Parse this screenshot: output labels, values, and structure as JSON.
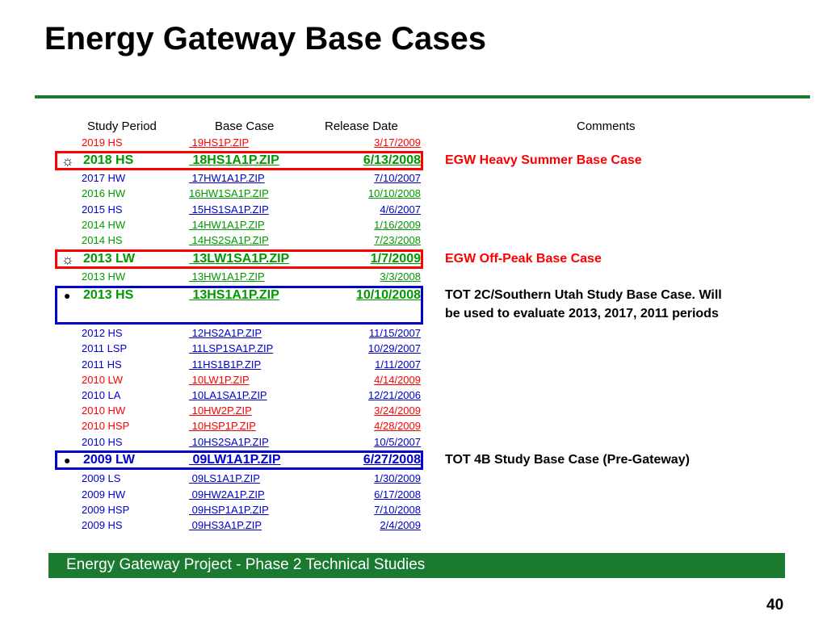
{
  "title": "Energy Gateway Base Cases",
  "headers": {
    "study_period": "Study Period",
    "base_case": "Base Case",
    "release_date": "Release Date",
    "comments": "Comments"
  },
  "rows": [
    {
      "period": "2019 HS",
      "file": "19HS1P.ZIP",
      "date": "3/17/2009",
      "color": "#ff0000",
      "style": "small"
    },
    {
      "period": "2018 HS",
      "file": "18HS1A1P.ZIP",
      "date": "6/13/2008",
      "color": "#009900",
      "style": "big",
      "marker": "☼",
      "comment": "EGW Heavy Summer Base Case",
      "comment_color": "#ff0000",
      "box_color": "#ff0000"
    },
    {
      "period": "2017 HW",
      "file": "17HW1A1P.ZIP",
      "date": "7/10/2007",
      "color": "#0000cc",
      "style": "small"
    },
    {
      "period": "2016 HW",
      "file": "16HW1SA1P.ZIP",
      "date": "10/10/2008",
      "color": "#009900",
      "style": "small"
    },
    {
      "period": "2015 HS",
      "file": "15HS1SA1P.ZIP",
      "date": "4/6/2007",
      "color": "#0000cc",
      "style": "small"
    },
    {
      "period": "2014 HW",
      "file": "14HW1A1P.ZIP",
      "date": "1/16/2009",
      "color": "#009900",
      "style": "small"
    },
    {
      "period": "2014 HS",
      "file": "14HS2SA1P.ZIP",
      "date": "7/23/2008",
      "color": "#009900",
      "style": "small"
    },
    {
      "period": "2013 LW",
      "file": "13LW1SA1P.ZIP",
      "date": "1/7/2009",
      "color": "#009900",
      "style": "big",
      "marker": "☼",
      "comment": "EGW Off-Peak Base Case",
      "comment_color": "#ff0000",
      "box_color": "#ff0000"
    },
    {
      "period": "2013 HW",
      "file": "13HW1A1P.ZIP",
      "date": "3/3/2008",
      "color": "#009900",
      "style": "small"
    },
    {
      "period": "2013 HS",
      "file": "13HS1A1P.ZIP",
      "date": "10/10/2008",
      "color": "#009900",
      "style": "big",
      "marker": "●",
      "comment": "TOT 2C/Southern Utah Study Base Case. Will",
      "comment2": "be used to evaluate 2013, 2017, 2011 periods",
      "comment_color": "#000000",
      "box_color": "#0000cc"
    },
    {
      "period": "2012 HS",
      "file": "12HS2A1P.ZIP",
      "date": "11/15/2007",
      "color": "#0000cc",
      "style": "small"
    },
    {
      "period": "2011 LSP",
      "file": "11LSP1SA1P.ZIP",
      "date": "10/29/2007",
      "color": "#0000cc",
      "style": "small"
    },
    {
      "period": "2011 HS",
      "file": "11HS1B1P.ZIP",
      "date": "1/11/2007",
      "color": "#0000cc",
      "style": "small"
    },
    {
      "period": "2010 LW",
      "file": "10LW1P.ZIP",
      "date": "4/14/2009",
      "color": "#ff0000",
      "style": "small"
    },
    {
      "period": "2010 LA",
      "file": "10LA1SA1P.ZIP",
      "date": "12/21/2006",
      "color": "#0000cc",
      "style": "small"
    },
    {
      "period": "2010 HW",
      "file": "10HW2P.ZIP",
      "date": "3/24/2009",
      "color": "#ff0000",
      "style": "small"
    },
    {
      "period": "2010 HSP",
      "file": "10HSP1P.ZIP",
      "date": "4/28/2009",
      "color": "#ff0000",
      "style": "small"
    },
    {
      "period": "2010 HS",
      "file": "10HS2SA1P.ZIP",
      "date": "10/5/2007",
      "color": "#0000cc",
      "style": "small"
    },
    {
      "period": "2009 LW",
      "file": "09LW1A1P.ZIP",
      "date": "6/27/2008",
      "color": "#0000cc",
      "style": "big",
      "marker": "●",
      "comment": "TOT 4B Study Base Case (Pre-Gateway)",
      "comment_color": "#000000",
      "box_color": "#0000cc"
    },
    {
      "period": "2009 LS",
      "file": "09LS1A1P.ZIP",
      "date": "1/30/2009",
      "color": "#0000cc",
      "style": "small"
    },
    {
      "period": "2009 HW",
      "file": "09HW2A1P.ZIP",
      "date": "6/17/2008",
      "color": "#0000cc",
      "style": "small"
    },
    {
      "period": "2009 HSP",
      "file": "09HSP1A1P.ZIP",
      "date": "7/10/2008",
      "color": "#0000cc",
      "style": "small"
    },
    {
      "period": "2009 HS",
      "file": "09HS3A1P.ZIP",
      "date": "2/4/2009",
      "color": "#0000cc",
      "style": "small"
    }
  ],
  "footer": "Energy Gateway Project - Phase 2 Technical Studies",
  "page_number": "40"
}
